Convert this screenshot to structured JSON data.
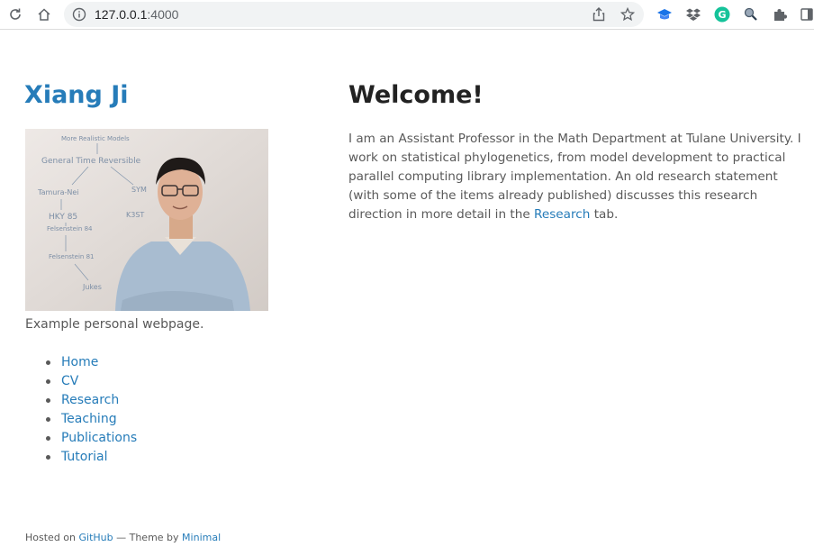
{
  "browser": {
    "url_host": "127.0.0.1",
    "url_port": ":4000",
    "icons": [
      "reload-icon",
      "home-icon",
      "info-icon",
      "share-icon",
      "bookmark-star-icon",
      "extension-graduation-icon",
      "dropbox-icon",
      "grammarly-icon",
      "extension-search-icon",
      "extensions-puzzle-icon",
      "side-panel-icon"
    ]
  },
  "sidebar": {
    "title": "Xiang Ji",
    "caption": "Example personal webpage.",
    "nav": [
      {
        "label": "Home"
      },
      {
        "label": "CV"
      },
      {
        "label": "Research"
      },
      {
        "label": "Teaching"
      },
      {
        "label": "Publications"
      },
      {
        "label": "Tutorial"
      }
    ]
  },
  "main": {
    "heading": "Welcome!",
    "para_before": "I am an Assistant Professor in the Math Department at Tulane University. I work on statistical phylogenetics, from model development to practical parallel computing library implementation. An old research statement (with some of the items already published) discusses this research direction in more detail in the ",
    "para_link": "Research",
    "para_after": " tab."
  },
  "footer": {
    "prefix": "Hosted on ",
    "github": "GitHub",
    "middle": " — Theme by ",
    "theme": "Minimal"
  },
  "photo_board_text": [
    "More Realistic Models",
    "General Time Reversible",
    "Tamura-Nei",
    "HKY 85",
    "Felsenstein 84",
    "Felsenstein 81",
    "Jukes",
    "K3ST",
    "SYM"
  ],
  "colors": {
    "link": "#267cb9",
    "text": "#595959",
    "heading": "#222222"
  }
}
